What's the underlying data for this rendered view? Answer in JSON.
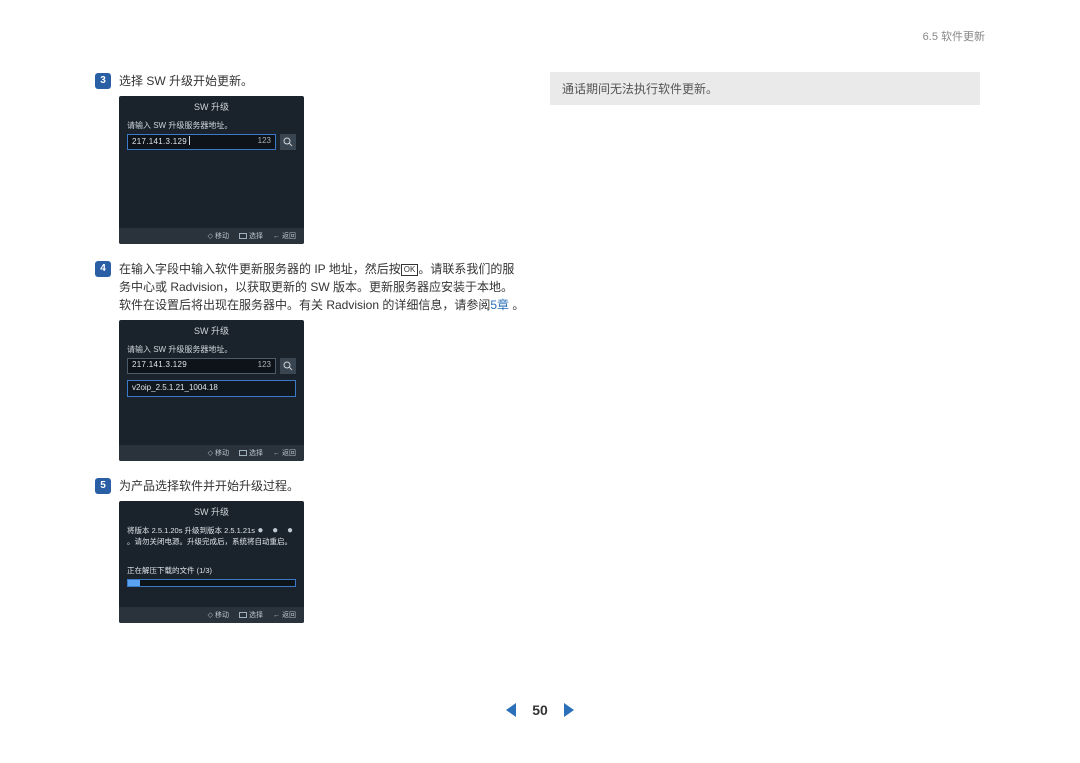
{
  "header": {
    "section": "6.5 软件更新"
  },
  "steps": {
    "s3": {
      "num": "3",
      "text": "选择 SW 升级开始更新。"
    },
    "s4": {
      "num": "4",
      "pre": "在输入字段中输入软件更新服务器的 IP 地址，然后按",
      "ok": "OK",
      "post": "。请联系我们的服务中心或 Radvision，以获取更新的 SW 版本。更新服务器应安装于本地。软件在设置后将出现在服务器中。有关 Radvision 的详细信息，请参阅",
      "link": "5章",
      "end": " 。"
    },
    "s5": {
      "num": "5",
      "text": "为产品选择软件并开始升级过程。"
    }
  },
  "panels": {
    "title": "SW 升级",
    "label": "请输入 SW 升级服务器地址。",
    "ip": "217.141.3.129",
    "count": "123",
    "version": "v2oip_2.5.1.21_1004.18",
    "upgrade_line1": "将版本 2.5.1.20s 升级到版本 2.5.1.21s",
    "upgrade_line2": "。请勿关闭电源。升级完成后，系统将自动重启。",
    "progress_label": "正在解压下载的文件 (1/3)",
    "foot_move": "移动",
    "foot_select": "选择",
    "foot_back": "返回"
  },
  "note": "通话期间无法执行软件更新。",
  "page": "50"
}
